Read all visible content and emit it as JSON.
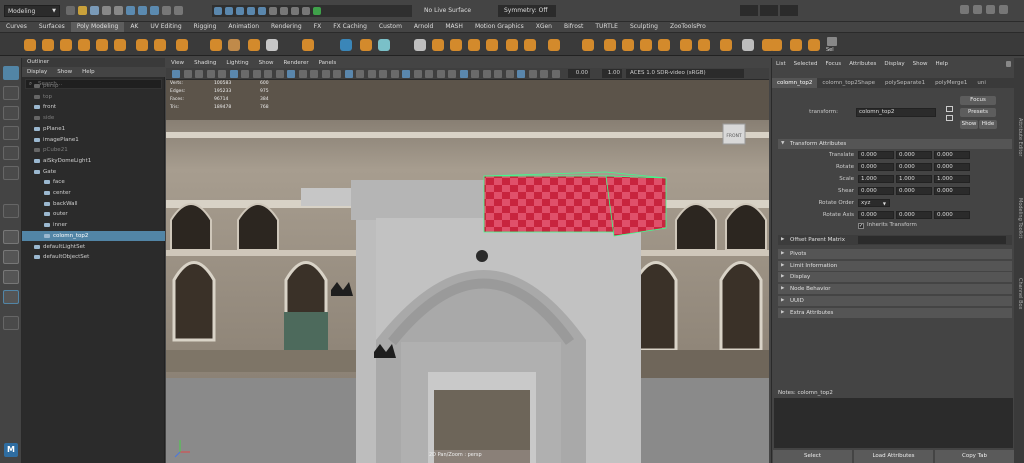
{
  "app": {
    "mode_menu": "Modeling",
    "live_surface": "No Live Surface",
    "symmetry": "Symmetry: Off"
  },
  "menubar": [
    "Curves",
    "Surfaces",
    "Poly Modeling",
    "AK",
    "UV Editing",
    "Rigging",
    "Animation",
    "Rendering",
    "FX",
    "FX Caching",
    "Custom",
    "Arnold",
    "MASH",
    "Motion Graphics",
    "XGen",
    "Bifrost",
    "TURTLE",
    "Sculpting",
    "ZooToolsPro"
  ],
  "shelf": {
    "sel_label": "Sel"
  },
  "outliner": {
    "title": "Outliner",
    "menu": [
      "Display",
      "Show",
      "Help"
    ],
    "search_placeholder": "Search...",
    "items": [
      {
        "label": "persp",
        "dim": true,
        "indent": 1
      },
      {
        "label": "top",
        "dim": true,
        "indent": 1
      },
      {
        "label": "front",
        "dim": false,
        "indent": 1
      },
      {
        "label": "side",
        "dim": true,
        "indent": 1
      },
      {
        "label": "pPlane1",
        "dim": false,
        "indent": 1
      },
      {
        "label": "imagePlane1",
        "dim": false,
        "indent": 1
      },
      {
        "label": "pCube21",
        "dim": true,
        "indent": 1
      },
      {
        "label": "aiSkyDomeLight1",
        "dim": false,
        "indent": 1
      },
      {
        "label": "Gate",
        "dim": false,
        "indent": 1
      },
      {
        "label": "face",
        "dim": false,
        "indent": 2
      },
      {
        "label": "center",
        "dim": false,
        "indent": 2
      },
      {
        "label": "backWall",
        "dim": false,
        "indent": 2
      },
      {
        "label": "outer",
        "dim": false,
        "indent": 2
      },
      {
        "label": "inner",
        "dim": false,
        "indent": 2
      },
      {
        "label": "colomn_top2",
        "dim": false,
        "indent": 2,
        "selected": true
      },
      {
        "label": "defaultLightSet",
        "dim": false,
        "indent": 1
      },
      {
        "label": "defaultObjectSet",
        "dim": false,
        "indent": 1
      }
    ]
  },
  "viewport": {
    "menu": [
      "View",
      "Shading",
      "Lighting",
      "Show",
      "Renderer",
      "Panels"
    ],
    "exposure": "0.00",
    "gamma": "1.00",
    "color_space": "ACES 1.0 SDR-video (sRGB)",
    "camera_label": "2D Pan/Zoom : persp",
    "stats": [
      {
        "name": "Verts:",
        "a": "100583",
        "b": "600"
      },
      {
        "name": "Edges:",
        "a": "195233",
        "b": "975"
      },
      {
        "name": "Faces:",
        "a": "96714",
        "b": "384"
      },
      {
        "name": "Tris:",
        "a": "189478",
        "b": "768"
      }
    ],
    "viewcube_label": "FRONT"
  },
  "attribute_editor": {
    "menu": [
      "List",
      "Selected",
      "Focus",
      "Attributes",
      "Display",
      "Show",
      "Help"
    ],
    "tabs": [
      "colomn_top2",
      "colomn_top2Shape",
      "polySeparate1",
      "polyMerge1",
      "uni"
    ],
    "transform_label": "transform:",
    "transform_value": "colomn_top2",
    "focus_btn": "Focus",
    "presets_btn": "Presets",
    "show_btn": "Show",
    "hide_btn": "Hide",
    "transform_section": "Transform Attributes",
    "rows": [
      {
        "label": "Translate",
        "v": [
          "0.000",
          "0.000",
          "0.000"
        ]
      },
      {
        "label": "Rotate",
        "v": [
          "0.000",
          "0.000",
          "0.000"
        ]
      },
      {
        "label": "Scale",
        "v": [
          "1.000",
          "1.000",
          "1.000"
        ]
      },
      {
        "label": "Shear",
        "v": [
          "0.000",
          "0.000",
          "0.000"
        ]
      }
    ],
    "rotate_order_label": "Rotate Order",
    "rotate_order_value": "xyz",
    "rotate_axis_label": "Rotate Axis",
    "rotate_axis_values": [
      "0.000",
      "0.000",
      "0.000"
    ],
    "inherits_transform": "Inherits Transform",
    "offset_parent_matrix": "Offset Parent Matrix",
    "sections": [
      "Pivots",
      "Limit Information",
      "Display",
      "Node Behavior",
      "UUID",
      "Extra Attributes"
    ],
    "notes_label": "Notes:  colomn_top2",
    "bottom_buttons": [
      "Select",
      "Load Attributes",
      "Copy Tab"
    ]
  },
  "right_strip_tabs": [
    "Attribute Editor",
    "Modeling Toolkit",
    "Channel Box"
  ],
  "accent_color": "#5285a6"
}
